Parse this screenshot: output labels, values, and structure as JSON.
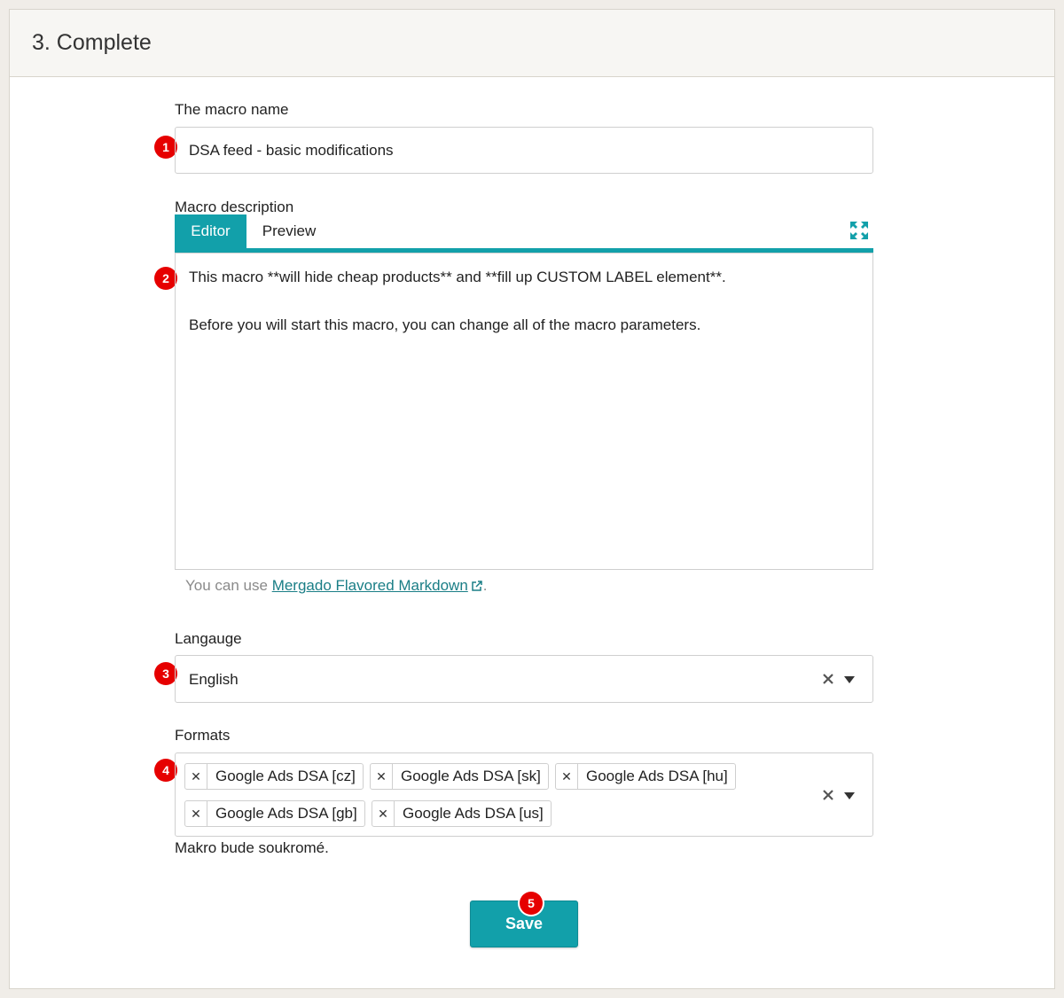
{
  "header": {
    "title": "3. Complete"
  },
  "macro_name": {
    "label": "The macro name",
    "value": "DSA feed - basic modifications",
    "badge": "1"
  },
  "description": {
    "label": "Macro description",
    "tabs": [
      {
        "label": "Editor"
      },
      {
        "label": "Preview"
      }
    ],
    "badge": "2",
    "lines": [
      "This macro **will hide cheap products** and **fill up CUSTOM LABEL element**.",
      "Before you will start this macro, you can change all of the macro parameters."
    ],
    "hint_prefix": "You can use",
    "hint_link": "Mergado Flavored Markdown",
    "hint_suffix": "."
  },
  "language": {
    "label": "Langauge",
    "value": "English",
    "badge": "3"
  },
  "formats": {
    "label": "Formats",
    "badge": "4",
    "tags": [
      "Google Ads DSA [cz]",
      "Google Ads DSA [sk]",
      "Google Ads DSA [hu]",
      "Google Ads DSA [gb]",
      "Google Ads DSA [us]"
    ]
  },
  "private_note": "Makro bude soukromé.",
  "save": {
    "label": "Save",
    "badge": "5"
  },
  "colors": {
    "accent": "#12a0aa",
    "badge": "#e60000",
    "link": "#1a7e86"
  }
}
